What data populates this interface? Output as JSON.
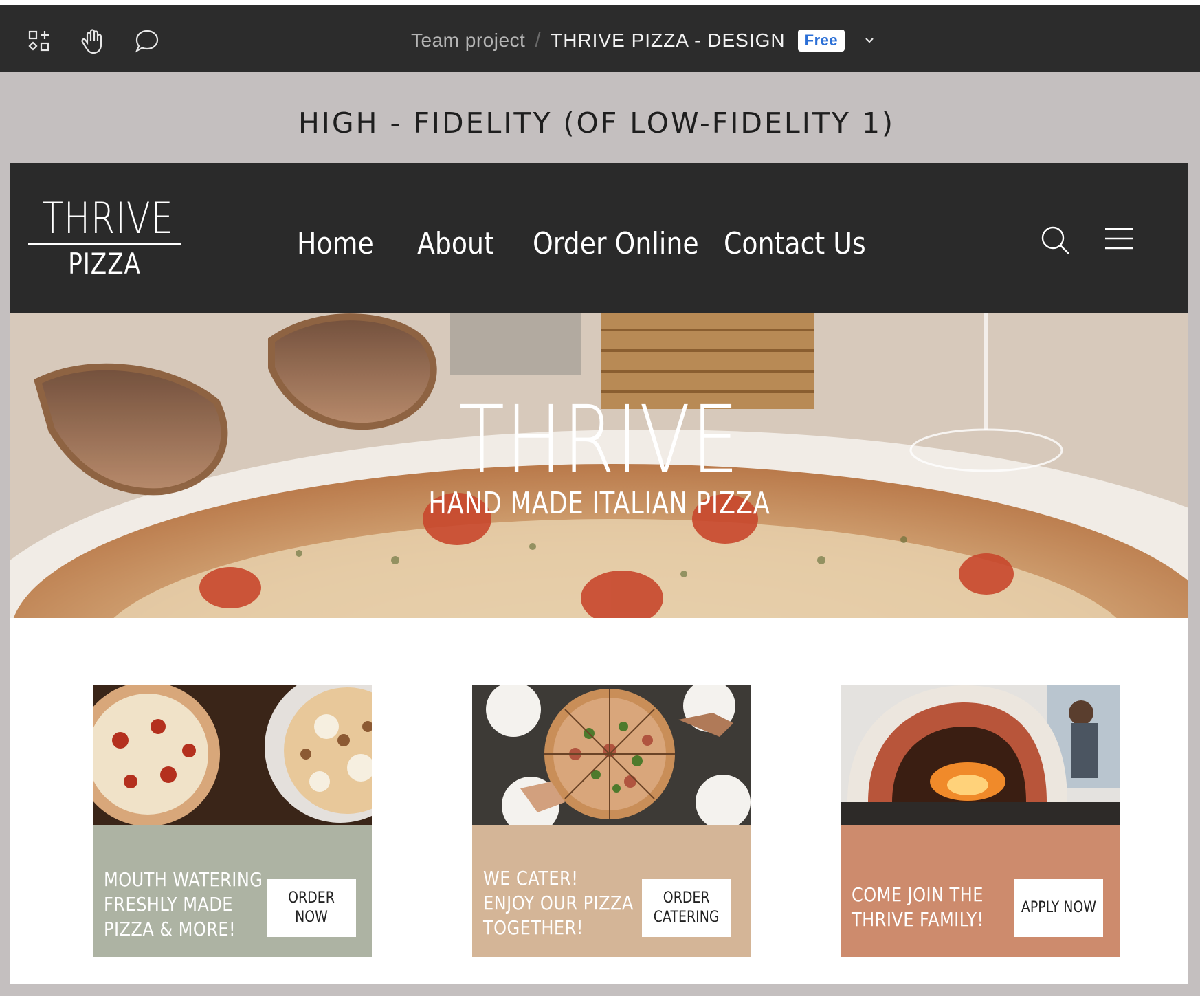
{
  "app": {
    "toolbar": {
      "tools": [
        {
          "icon": "assets-icon"
        },
        {
          "icon": "hand-icon"
        },
        {
          "icon": "comment-icon"
        }
      ]
    },
    "breadcrumb": {
      "project": "Team project",
      "separator": "/",
      "file": "THRIVE PIZZA - DESIGN",
      "plan_badge": "Free",
      "menu_icon": "chevron-down-icon"
    }
  },
  "frame": {
    "title": "HIGH - FIDELITY  (OF LOW-FIDELITY 1)"
  },
  "site": {
    "logo": {
      "line1": "THRIVE",
      "line2": "PIZZA"
    },
    "nav": [
      "Home",
      "About",
      "Order Online",
      "Contact Us"
    ],
    "header_icons": [
      "search-icon",
      "menu-icon"
    ],
    "hero": {
      "title": "THRIVE",
      "subtitle": "HAND MADE ITALIAN PIZZA"
    },
    "cards": [
      {
        "text": "MOUTH WATERING\nFRESHLY MADE\nPIZZA & MORE!",
        "button": "ORDER NOW",
        "color": "#adb3a3"
      },
      {
        "text": "WE CATER!\nENJOY OUR PIZZA\nTOGETHER!",
        "button": "ORDER\nCATERING",
        "color": "#d4b597"
      },
      {
        "text": "COME JOIN THE\nTHRIVE FAMILY!",
        "button": "APPLY NOW",
        "color": "#cd8b6d"
      }
    ]
  },
  "colors": {
    "app_bar": "#2c2c2c",
    "canvas": "#c4bfbf",
    "badge_text": "#2b6fd6",
    "site_header": "#2a2a2a"
  }
}
